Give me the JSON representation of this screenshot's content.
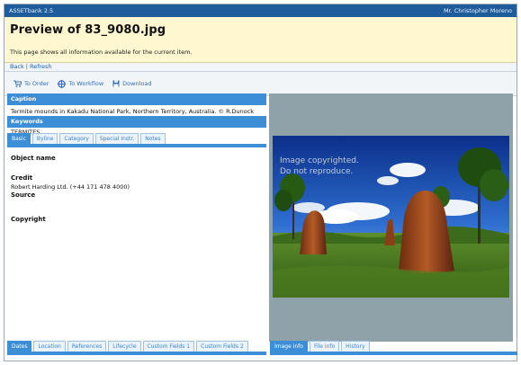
{
  "app": {
    "title": "ASSETbank 2.5",
    "user": "Mr. Christopher Moreno"
  },
  "page": {
    "title": "Preview of 83_9080.jpg",
    "description": "This page shows all information available for the current item."
  },
  "nav": {
    "back": "Back",
    "separator": "|",
    "refresh": "Refresh"
  },
  "toolbar": {
    "order": "To Order",
    "workflow": "To Workflow",
    "download": "Download"
  },
  "caption": {
    "header": "Caption",
    "text": "Termite mounds in Kakadu National Park, Northern Territory, Australia. © R.Dunock"
  },
  "keywords": {
    "header": "Keywords",
    "text": "TERMITES"
  },
  "detail_tabs": [
    "Basic",
    "Byline",
    "Category",
    "Special Instr.",
    "Notes"
  ],
  "fields": {
    "object_name_label": "Object name",
    "credit_label": "Credit",
    "credit_value": "Robert Harding Ltd. (+44 171 478 4000)",
    "source_label": "Source",
    "copyright_label": "Copyright"
  },
  "bottom_tabs_left": [
    "Dates",
    "Location",
    "References",
    "Lifecycle",
    "Custom Fields 1",
    "Custom Fields 2"
  ],
  "bottom_tabs_right": [
    "Image info",
    "File info",
    "History"
  ],
  "watermark": [
    "Image copyrighted.",
    "Do not reproduce."
  ],
  "colors": {
    "topbar": "#1e5c9c",
    "title_bg": "#fff7cf",
    "section_header": "#3c8ed6",
    "preview_bg": "#8fa1a9",
    "link": "#1f5fa8"
  },
  "icons": {
    "order": "cart-icon",
    "workflow": "workflow-icon",
    "download": "disk-icon"
  }
}
